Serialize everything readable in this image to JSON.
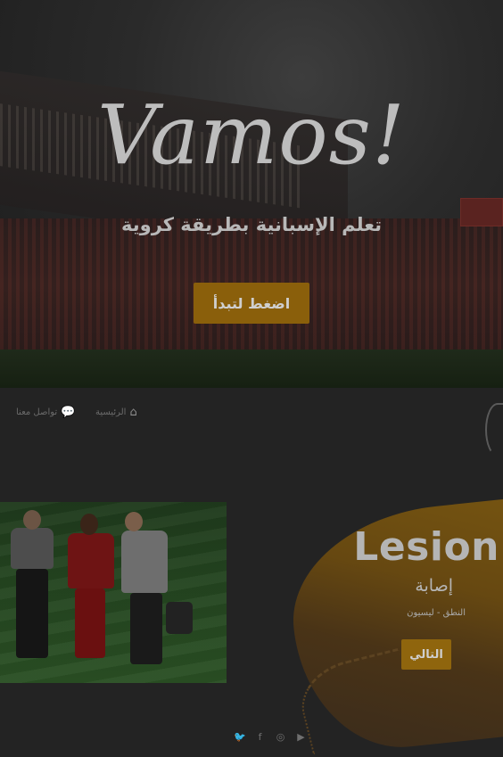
{
  "hero": {
    "title": "Vamos!",
    "subtitle": "تعلم الإسبانية بطريقة كروية",
    "cta_label": "اضغط لتبدأ"
  },
  "nav": {
    "home_label": "الرئيسية",
    "home_icon": "home-icon",
    "contact_label": "تواصل معنا",
    "contact_icon": "chat-bubbles-icon"
  },
  "lesson": {
    "title": "Lesion",
    "translation": "إصابة",
    "meta": "النطق - ليسيون",
    "next_label": "التالي",
    "image": "injured-player-with-staff"
  },
  "footer": {
    "social": [
      {
        "icon": "twitter-icon",
        "glyph": "🐦"
      },
      {
        "icon": "facebook-icon",
        "glyph": "f"
      },
      {
        "icon": "instagram-icon",
        "glyph": "◎"
      },
      {
        "icon": "youtube-icon",
        "glyph": "▶"
      }
    ]
  },
  "colors": {
    "accent": "#8a5f0b",
    "background": "#232323"
  }
}
